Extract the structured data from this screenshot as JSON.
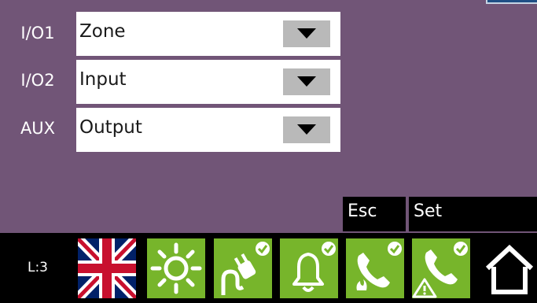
{
  "rows": [
    {
      "label": "I/O1",
      "value": "Zone"
    },
    {
      "label": "I/O2",
      "value": "Input"
    },
    {
      "label": "AUX",
      "value": "Output"
    }
  ],
  "buttons": {
    "esc": "Esc",
    "set": "Set"
  },
  "status_bar": {
    "level": "L:3",
    "icons": [
      "uk-flag-icon",
      "brightness-icon",
      "power-plug-icon",
      "bell-icon",
      "fire-call-icon",
      "alarm-call-icon",
      "home-icon"
    ]
  },
  "colors": {
    "background": "#715577",
    "tile_green": "#77b52b",
    "bar": "#000000"
  }
}
